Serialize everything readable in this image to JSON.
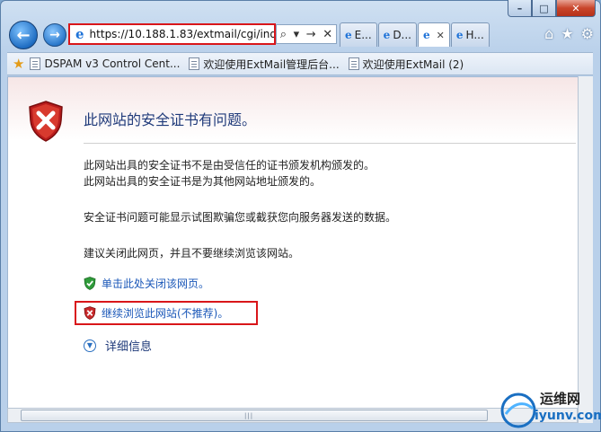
{
  "browser": {
    "address_url": "https://10.188.1.83/extmail/cgi/ind",
    "tabs": [
      {
        "label": "E..."
      },
      {
        "label": "D..."
      },
      {
        "label": ""
      },
      {
        "label": "H..."
      }
    ],
    "favorites": [
      {
        "label": "DSPAM v3 Control Cent..."
      },
      {
        "label": "欢迎使用ExtMail管理后台..."
      },
      {
        "label": "欢迎使用ExtMail (2)"
      }
    ]
  },
  "page": {
    "title": "此网站的安全证书有问题。",
    "line1": "此网站出具的安全证书不是由受信任的证书颁发机构颁发的。",
    "line2": "此网站出具的安全证书是为其他网站地址颁发的。",
    "line3": "安全证书问题可能显示试图欺骗您或截获您向服务器发送的数据。",
    "line4": "建议关闭此网页，并且不要继续浏览该网站。",
    "close_link": "单击此处关闭该网页。",
    "continue_link": "继续浏览此网站(不推荐)。",
    "more_info": "详细信息"
  },
  "watermark": {
    "line1": "运维网",
    "line2": "iyunv.com"
  }
}
